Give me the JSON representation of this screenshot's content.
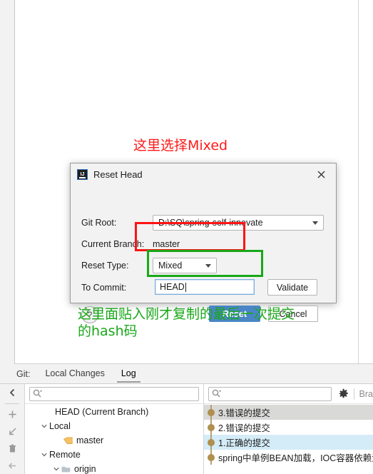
{
  "editor": {
    "empty": ""
  },
  "annotations": {
    "top_note": "这里选择Mixed",
    "bottom_note_line1": "这里面贴入刚才复制的最后一次提交",
    "bottom_note_line2": "的hash码"
  },
  "dialog": {
    "title": "Reset Head",
    "app_icon": "IJ",
    "close_icon": "close-icon",
    "fields": {
      "git_root_label": "Git Root:",
      "git_root_value": "D:\\SQ\\spring-self-innovate",
      "current_branch_label": "Current Branch:",
      "current_branch_value": "master",
      "reset_type_label": "Reset Type:",
      "reset_type_value": "Mixed",
      "to_commit_label": "To Commit:",
      "to_commit_value": "HEAD",
      "validate_label": "Validate"
    },
    "buttons": {
      "help_label": "?",
      "reset_label": "Reset",
      "cancel_label": "Cancel"
    }
  },
  "git_tool": {
    "title": "Git:",
    "tabs": [
      {
        "label": "Local Changes",
        "active": false
      },
      {
        "label": "Log",
        "active": true
      }
    ],
    "actions": [
      "collapse-icon",
      "add-icon",
      "checkout-icon",
      "delete-icon",
      "back-icon"
    ],
    "branch_search_placeholder": "",
    "commit_search_placeholder": "",
    "settings_icon": "gear-icon",
    "branch_filter_label": "Bra",
    "branches": [
      {
        "label": "HEAD (Current Branch)",
        "indent": 2,
        "chevron": "",
        "icon": ""
      },
      {
        "label": "Local",
        "indent": 1,
        "chevron": "˅",
        "icon": ""
      },
      {
        "label": "master",
        "indent": 3,
        "chevron": "",
        "icon": "tag-icon"
      },
      {
        "label": "Remote",
        "indent": 1,
        "chevron": "˅",
        "icon": ""
      },
      {
        "label": "origin",
        "indent": 2,
        "chevron": "˅",
        "icon": "folder-icon"
      }
    ],
    "commits": [
      {
        "message": "3.错误的提交",
        "state": "selected"
      },
      {
        "message": "2.错误的提交",
        "state": "normal"
      },
      {
        "message": "1.正确的提交",
        "state": "highlighted"
      },
      {
        "message": "spring中单例BEAN加载，IOC容器依赖注",
        "state": "normal"
      }
    ]
  },
  "colors": {
    "accent_blue": "#4a86c5",
    "annotation_red": "#ff1414",
    "annotation_green": "#18a818",
    "graph_node": "#b08f4f",
    "selection_gray": "#d9d9d8",
    "selection_blue": "#d4ecf7"
  }
}
